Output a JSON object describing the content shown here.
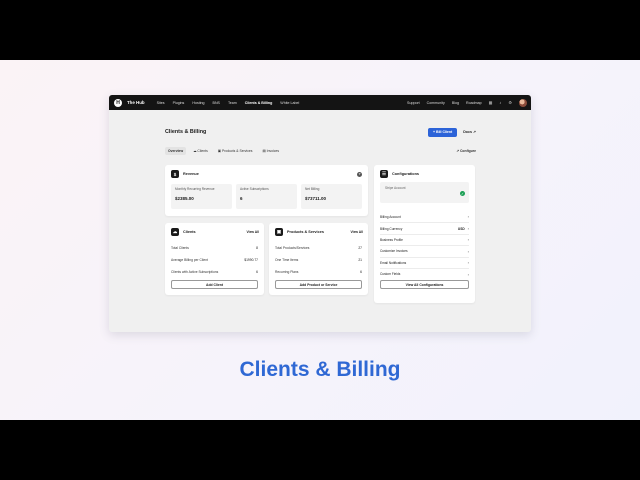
{
  "app": {
    "brand": "The Hub",
    "logo_letter": "H"
  },
  "nav": {
    "items": [
      {
        "label": "Sites",
        "active": false
      },
      {
        "label": "Plugins",
        "active": false
      },
      {
        "label": "Hosting",
        "active": false
      },
      {
        "label": "BNS",
        "active": false
      },
      {
        "label": "Team",
        "active": false
      },
      {
        "label": "Clients & Billing",
        "active": true
      },
      {
        "label": "White Label",
        "active": false
      }
    ],
    "right_items": [
      "Support",
      "Community",
      "Blog",
      "Roadmap"
    ],
    "icons": [
      "grid-icon",
      "bell-icon",
      "gear-icon"
    ]
  },
  "page": {
    "title": "Clients & Billing",
    "bill_client_label": "+ Bill Client",
    "docs_label": "Docs ↗"
  },
  "tabs": {
    "items": [
      "Overview",
      "☁ Clients",
      "▣ Products & Services",
      "▤ Invoices"
    ],
    "active": 0,
    "configure_label": "↗ Configure"
  },
  "revenue": {
    "title": "Revenue",
    "help": "?",
    "stats": [
      {
        "label": "Monthly Recurring Revenue",
        "value": "$2385.00"
      },
      {
        "label": "Active Subscriptions",
        "value": "6"
      },
      {
        "label": "Net Billing",
        "value": "$73711.00"
      }
    ]
  },
  "clients": {
    "title": "Clients",
    "view_all": "View All",
    "rows": [
      {
        "label": "Total Clients",
        "value": "8"
      },
      {
        "label": "Average Billing per Client",
        "value": "$1990.77"
      },
      {
        "label": "Clients with Active Subscriptions",
        "value": "6"
      }
    ],
    "button": "Add Client"
  },
  "products": {
    "title": "Products & Services",
    "view_all": "View All",
    "rows": [
      {
        "label": "Total Products/Services",
        "value": "27"
      },
      {
        "label": "One Time Items",
        "value": "21"
      },
      {
        "label": "Recurring Plans",
        "value": "6"
      }
    ],
    "button": "Add Product or Service"
  },
  "configurations": {
    "title": "Configurations",
    "stripe_label": "Stripe Account",
    "rows": [
      {
        "label": "Billing Account",
        "value": ""
      },
      {
        "label": "Billing Currency",
        "value": "USD"
      },
      {
        "label": "Business Profile",
        "value": ""
      },
      {
        "label": "Customize Invoices",
        "value": ""
      },
      {
        "label": "Email Notifications",
        "value": ""
      },
      {
        "label": "Custom Fields",
        "value": ""
      }
    ],
    "button": "View All Configurations"
  },
  "caption": "Clients & Billing",
  "colors": {
    "accent": "#2c63d8",
    "caption": "#2f68d4",
    "nav_bg": "#141414",
    "success": "#1a9f54"
  }
}
